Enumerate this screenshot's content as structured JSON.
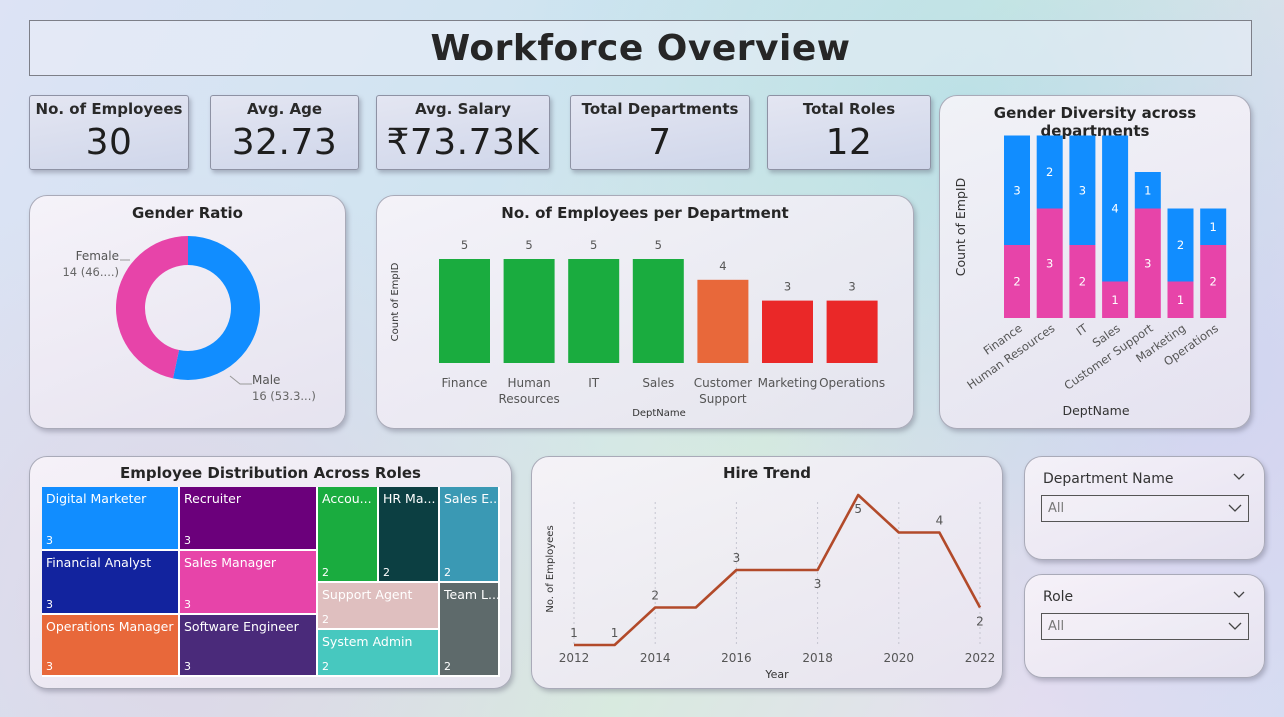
{
  "title": "Workforce Overview",
  "kpis": [
    {
      "label": "No. of Employees",
      "value": "30"
    },
    {
      "label": "Avg. Age",
      "value": "32.73"
    },
    {
      "label": "Avg. Salary",
      "value": "₹73.73K"
    },
    {
      "label": "Total Departments",
      "value": "7"
    },
    {
      "label": "Total Roles",
      "value": "12"
    }
  ],
  "colors": {
    "male": "#118dff",
    "female": "#e744a9",
    "green": "#1aac3f",
    "orange": "#e8683a",
    "red": "#ea2828",
    "line": "#b24a2a"
  },
  "chart_data": [
    {
      "type": "pie",
      "title": "Gender Ratio",
      "slices": [
        {
          "name": "Male",
          "value": 16,
          "label": "16 (53.3...)"
        },
        {
          "name": "Female",
          "value": 14,
          "label": "14 (46....)"
        }
      ],
      "donut": true
    },
    {
      "type": "bar",
      "title": "No. of Employees per Department",
      "categories": [
        "Finance",
        "Human Resources",
        "IT",
        "Sales",
        "Customer Support",
        "Marketing",
        "Operations"
      ],
      "category_lines": [
        [
          "Finance"
        ],
        [
          "Human",
          "Resources"
        ],
        [
          "IT"
        ],
        [
          "Sales"
        ],
        [
          "Customer",
          "Support"
        ],
        [
          "Marketing"
        ],
        [
          "Operations"
        ]
      ],
      "values": [
        5,
        5,
        5,
        5,
        4,
        3,
        3
      ],
      "xlabel": "DeptName",
      "ylabel": "Count of EmpID",
      "ylim": [
        0,
        5
      ]
    },
    {
      "type": "bar",
      "stacked": true,
      "title": "Gender Diversity across departments",
      "categories": [
        "Finance",
        "Human Resources",
        "IT",
        "Sales",
        "Customer Support",
        "Marketing",
        "Operations"
      ],
      "series": [
        {
          "name": "Female",
          "values": [
            2,
            3,
            2,
            1,
            3,
            1,
            2
          ]
        },
        {
          "name": "Male",
          "values": [
            3,
            2,
            3,
            4,
            1,
            2,
            1
          ]
        }
      ],
      "xlabel": "DeptName",
      "ylabel": "Count of EmpID",
      "ylim": [
        0,
        5
      ]
    },
    {
      "type": "treemap",
      "title": "Employee Distribution Across Roles",
      "items": [
        {
          "name": "Digital Marketer",
          "value": 3
        },
        {
          "name": "Recruiter",
          "value": 3
        },
        {
          "name": "Financial Analyst",
          "value": 3
        },
        {
          "name": "Sales Manager",
          "value": 3
        },
        {
          "name": "Operations Manager",
          "value": 3
        },
        {
          "name": "Software Engineer",
          "value": 3
        },
        {
          "name": "Accou...",
          "value": 2
        },
        {
          "name": "HR Ma...",
          "value": 2
        },
        {
          "name": "Sales E...",
          "value": 2
        },
        {
          "name": "Support Agent",
          "value": 2
        },
        {
          "name": "Team L...",
          "value": 2
        },
        {
          "name": "System Admin",
          "value": 2
        }
      ]
    },
    {
      "type": "line",
      "title": "Hire Trend",
      "x": [
        2012,
        2013,
        2014,
        2015,
        2016,
        2017,
        2018,
        2019,
        2020,
        2021,
        2022
      ],
      "y": [
        1,
        1,
        2,
        2,
        3,
        3,
        3,
        5,
        4,
        4,
        2
      ],
      "labeled_points": [
        2012,
        2013,
        2014,
        2016,
        2018,
        2019,
        2021,
        2022
      ],
      "xticks": [
        2012,
        2014,
        2016,
        2018,
        2020,
        2022
      ],
      "xlabel": "Year",
      "ylabel": "No. of Employees"
    }
  ],
  "slicers": [
    {
      "label": "Department Name",
      "value": "All"
    },
    {
      "label": "Role",
      "value": "All"
    }
  ]
}
